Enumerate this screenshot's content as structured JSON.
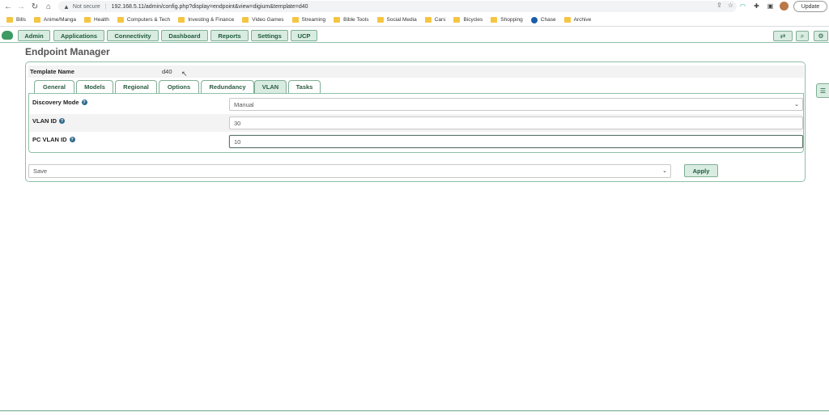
{
  "browser": {
    "not_secure": "Not secure",
    "url": "192.168.5.11/admin/config.php?display=endpoint&view=digium&template=d40",
    "update_label": "Update"
  },
  "bookmarks": [
    "Bills",
    "Anime/Manga",
    "Health",
    "Computers & Tech",
    "Investing & Finance",
    "Video Games",
    "Streaming",
    "Bible Tools",
    "Social Media",
    "Cars",
    "Bicycles",
    "Shopping",
    "Chase",
    "Archive"
  ],
  "nav": {
    "items": [
      "Admin",
      "Applications",
      "Connectivity",
      "Dashboard",
      "Reports",
      "Settings",
      "UCP"
    ]
  },
  "page": {
    "title": "Endpoint Manager",
    "template_label": "Template Name",
    "template_value": "d40"
  },
  "tabs": [
    "General",
    "Models",
    "Regional",
    "Options",
    "Redundancy",
    "VLAN",
    "Tasks"
  ],
  "active_tab": "VLAN",
  "fields": [
    {
      "label": "Discovery Mode",
      "value": "Manual",
      "type": "select"
    },
    {
      "label": "VLAN ID",
      "value": "30",
      "type": "text"
    },
    {
      "label": "PC VLAN ID",
      "value": "10",
      "type": "text"
    }
  ],
  "footer": {
    "save_value": "Save",
    "apply_label": "Apply"
  },
  "colors": {
    "accent": "#d9ece1",
    "accent_border": "#7fae95",
    "accent_text": "#1e5a3a"
  }
}
